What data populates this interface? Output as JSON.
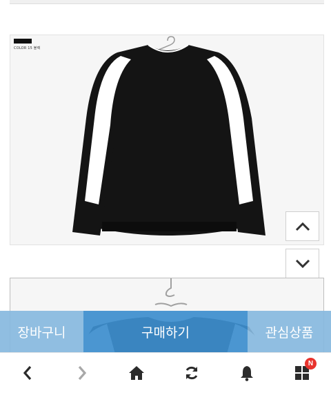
{
  "product": {
    "color_caption": "COLOR 15 블랙"
  },
  "scroll": {
    "up_icon": "chevron-up-icon",
    "down_icon": "chevron-down-icon"
  },
  "actions": {
    "cart_label": "장바구니",
    "buy_label": "구매하기",
    "wishlist_label": "관심상품"
  },
  "nav": {
    "items": [
      "back-icon",
      "forward-icon",
      "home-icon",
      "refresh-icon",
      "bell-icon",
      "apps-icon"
    ],
    "badge": "N"
  },
  "colors": {
    "buy_button": "#3d8ecd",
    "side_buttons": "#87b9de",
    "badge": "#e8332d",
    "icons": "#333333"
  }
}
